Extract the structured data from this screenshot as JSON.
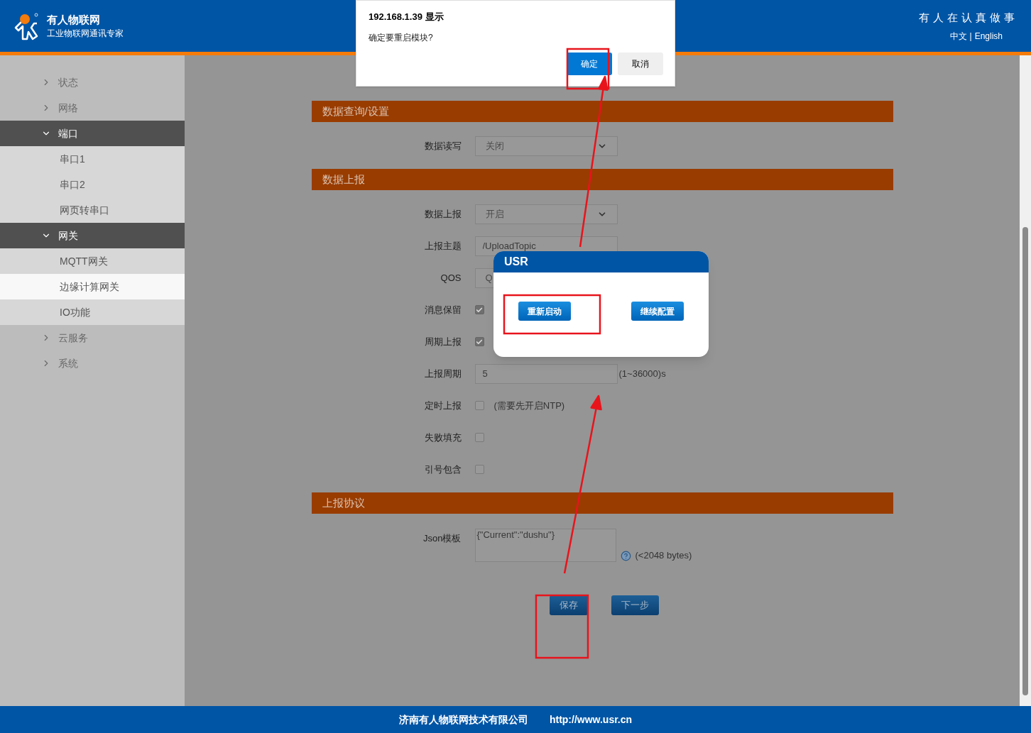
{
  "header": {
    "brand": "有人物联网",
    "tagline": "工业物联网通讯专家",
    "slogan": "有人在认真做事",
    "languages": [
      "中文",
      "English"
    ],
    "separator": "|"
  },
  "sidebar": {
    "items": [
      {
        "label": "状态",
        "expanded": false
      },
      {
        "label": "网络",
        "expanded": false
      },
      {
        "label": "端口",
        "expanded": true,
        "children": [
          {
            "label": "串口1",
            "selected": false
          },
          {
            "label": "串口2",
            "selected": false
          },
          {
            "label": "网页转串口",
            "selected": false
          }
        ]
      },
      {
        "label": "网关",
        "expanded": true,
        "children": [
          {
            "label": "MQTT网关",
            "selected": false
          },
          {
            "label": "边缘计算网关",
            "selected": true
          },
          {
            "label": "IO功能",
            "selected": false
          }
        ]
      },
      {
        "label": "云服务",
        "expanded": false
      },
      {
        "label": "系统",
        "expanded": false
      }
    ]
  },
  "sections": [
    {
      "title": "数据查询/设置",
      "rows": [
        {
          "kind": "select",
          "label": "数据读写",
          "value": "关闭"
        }
      ]
    },
    {
      "title": "数据上报",
      "rows": [
        {
          "kind": "select",
          "label": "数据上报",
          "value": "开启"
        },
        {
          "kind": "text",
          "label": "上报主题",
          "value": "/UploadTopic"
        },
        {
          "kind": "select",
          "label": "QOS",
          "value": "Q"
        },
        {
          "kind": "checkbox",
          "label": "消息保留",
          "checked": true
        },
        {
          "kind": "checkbox",
          "label": "周期上报",
          "checked": true
        },
        {
          "kind": "text",
          "label": "上报周期",
          "value": "5",
          "note": "(1~36000)s"
        },
        {
          "kind": "checkbox",
          "label": "定时上报",
          "checked": false,
          "note": "(需要先开启NTP)"
        },
        {
          "kind": "checkbox",
          "label": "失败填充",
          "checked": false
        },
        {
          "kind": "checkbox",
          "label": "引号包含",
          "checked": false
        }
      ]
    },
    {
      "title": "上报协议",
      "rows": [
        {
          "kind": "textarea",
          "label": "Json模板",
          "value": "{\"Current\":\"dushu\"}",
          "note": "(<2048 bytes)"
        }
      ]
    }
  ],
  "actions": [
    "保存",
    "下一步"
  ],
  "alert": {
    "title": "192.168.1.39 显示",
    "message": "确定要重启模块?",
    "buttons": [
      {
        "label": "确定",
        "kind": "primary"
      },
      {
        "label": "取消",
        "kind": "secondary"
      }
    ]
  },
  "dialog": {
    "title": "USR",
    "buttons": [
      "重新启动",
      "继续配置"
    ]
  },
  "footer": {
    "company": "济南有人物联网技术有限公司",
    "url": "http://www.usr.cn"
  }
}
